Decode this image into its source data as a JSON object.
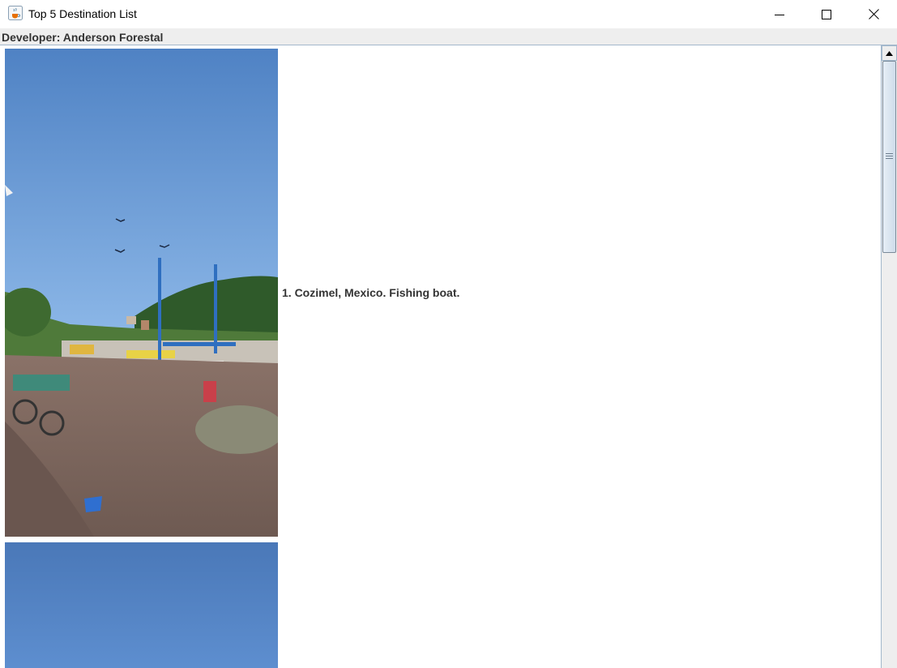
{
  "window": {
    "title": "Top 5 Destination List",
    "icon": "java-coffee-cup-icon",
    "controls": [
      "minimize-icon",
      "maximize-icon",
      "close-icon"
    ]
  },
  "header": {
    "developer_label": "Developer: Anderson Forestal"
  },
  "destinations": [
    {
      "caption": "1. Cozimel, Mexico. Fishing boat.",
      "image": "fishing-boat-dock-photo"
    },
    {
      "caption": "",
      "image": "blue-sky-photo"
    }
  ],
  "scrollbar": {
    "position_fraction": 0.0,
    "visible_fraction": 0.25
  }
}
